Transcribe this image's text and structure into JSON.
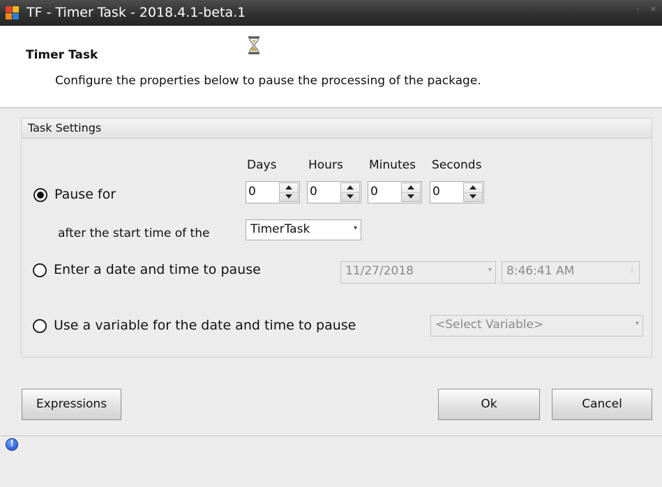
{
  "window": {
    "title": "TF - Timer Task - 2018.4.1-beta.1",
    "controls": "- ×"
  },
  "header": {
    "title": "Timer Task",
    "description": "Configure the properties below to pause the processing of the package."
  },
  "group": {
    "title": "Task Settings"
  },
  "duration": {
    "columns": [
      "Days",
      "Hours",
      "Minutes",
      "Seconds"
    ],
    "values": [
      "0",
      "0",
      "0",
      "0"
    ]
  },
  "options": {
    "pause_for": {
      "label": "Pause for",
      "selected": true
    },
    "date_time": {
      "label": "Enter a date and time to pause",
      "selected": false
    },
    "variable": {
      "label": "Use a variable for the date and time to pause",
      "selected": false
    }
  },
  "after_start": {
    "label": "after the start time of the",
    "selected": "TimerTask"
  },
  "date_field": {
    "value": "11/27/2018"
  },
  "time_field": {
    "value": "8:46:41 AM"
  },
  "variable_select": {
    "value": "<Select Variable>"
  },
  "buttons": {
    "expressions": "Expressions",
    "ok": "Ok",
    "cancel": "Cancel"
  },
  "colors": {
    "title_bar": "#2f2f2f",
    "header_bg": "#ffffff",
    "body_bg": "#ececec"
  }
}
